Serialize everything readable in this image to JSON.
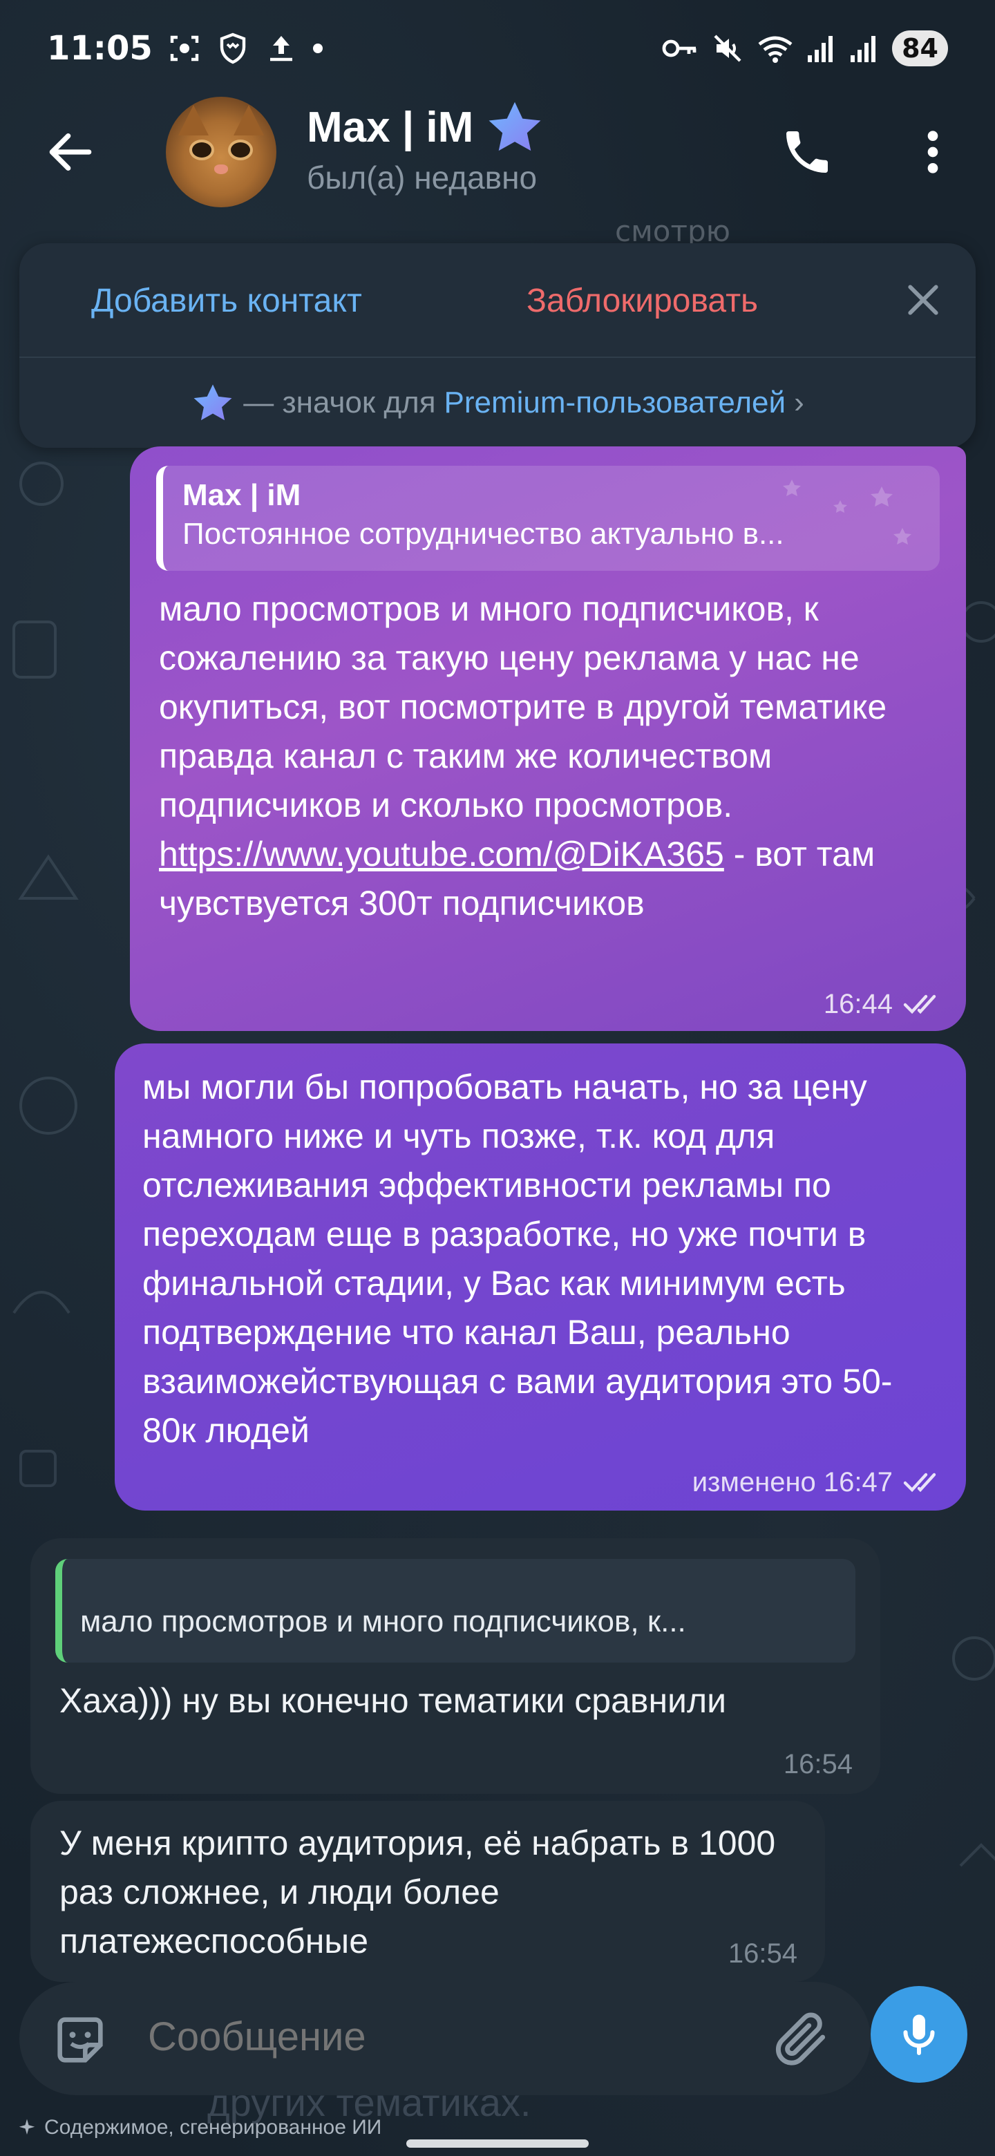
{
  "status_bar": {
    "time": "11:05",
    "battery": "84"
  },
  "header": {
    "name": "Max | iM",
    "status": "был(а) недавно"
  },
  "faded_previous": "смотрю",
  "action_bar": {
    "add_contact": "Добавить контакт",
    "block": "Заблокировать",
    "premium_prefix": "— значок для ",
    "premium_link": "Premium-пользователей",
    "premium_chevron": "›"
  },
  "messages": [
    {
      "direction": "outgoing",
      "reply_name": "Max | iM",
      "reply_text": "Постоянное сотрудничество актуально в...",
      "text_before_link": "мало просмотров и много подписчиков, к сожалению за такую цену реклама у нас не окупиться, вот посмотрите в другой тематике правда канал с таким же количеством подписчиков и сколько просмотров. ",
      "link": "https://www.youtube.com/@DiKA365",
      "text_after_link": " - вот там чувствуется 300т подписчиков",
      "time": "16:44"
    },
    {
      "direction": "outgoing",
      "text": "мы могли бы попробовать начать, но за цену намного ниже и чуть позже, т.к. код для отслеживания эффективности рекламы по переходам еще в разработке, но уже почти в финальной стадии, у Вас как минимум есть подтверждение что канал Ваш, реально взаиможействующая с вами аудитория это 50-80к людей",
      "time": "изменено 16:47"
    },
    {
      "direction": "incoming",
      "reply_text": "мало просмотров и много подписчиков, к...",
      "text": "Хаха))) ну вы конечно тематики сравнили",
      "time": "16:54"
    },
    {
      "direction": "incoming",
      "text": "У меня крипто аудитория, её набрать в 1000 раз сложнее, и люди более платежеспособные",
      "time": "16:54"
    }
  ],
  "input": {
    "placeholder": "Сообщение"
  },
  "below_text": "других тематиках.",
  "ai_note": "Содержимое, сгенерированное ИИ",
  "colors": {
    "background": "#17212b",
    "accent": "#6ab3f3",
    "block_red": "#ef6b6b",
    "outgoing_bubble": "#8f4fcb",
    "incoming_bubble": "#222d37",
    "mic_button": "#3a9de6"
  },
  "icons": [
    "back-arrow-icon",
    "phone-icon",
    "more-vertical-icon",
    "premium-star-icon",
    "close-icon",
    "double-check-icon",
    "sticker-icon",
    "attach-icon",
    "mic-icon",
    "sparkle-icon"
  ]
}
